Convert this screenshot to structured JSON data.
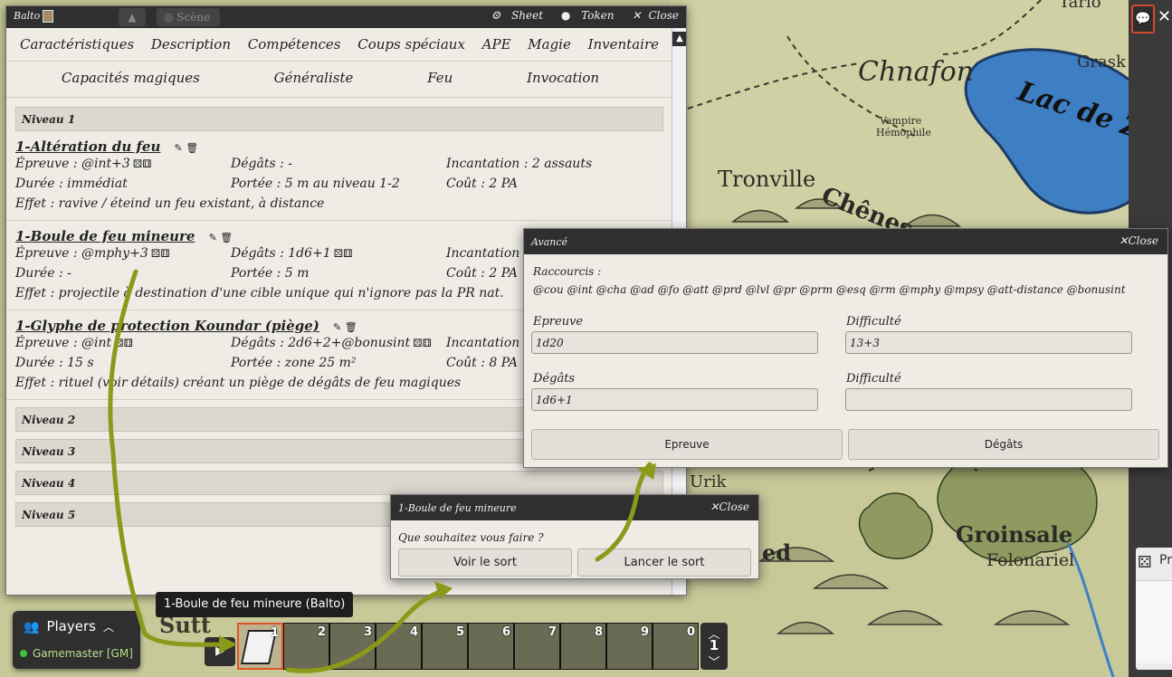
{
  "map": {
    "labels": [
      "Chnafon",
      "Grask",
      "Lac de Zblouf",
      "Vampire",
      "Hémophile",
      "Tronville",
      "Chênes",
      "Urik",
      "Groinsale",
      "Folonariel",
      "ed",
      "Sutt",
      "Tarlo"
    ]
  },
  "sheet": {
    "character_name": "Balto",
    "scene_label": "Scène",
    "actions": {
      "sheet": "Sheet",
      "token": "Token",
      "close": "Close"
    },
    "tabs": [
      "Caractéristiques",
      "Description",
      "Compétences",
      "Coups spéciaux",
      "APE",
      "Magie",
      "Inventaire"
    ],
    "subtabs": [
      "Capacités magiques",
      "Généraliste",
      "Feu",
      "Invocation"
    ],
    "niveau1": "Niveau 1",
    "spells": [
      {
        "name": "1-Altération du feu",
        "epreuve": "Épreuve : @int+3",
        "degats": "Dégâts : -",
        "incantation": "Incantation : 2 assauts",
        "duree": "Durée : immédiat",
        "portee": "Portée : 5 m au niveau 1-2",
        "cout": "Coût : 2 PA",
        "effet": "Effet : ravive / éteind un feu existant, à distance"
      },
      {
        "name": "1-Boule de feu mineure",
        "epreuve": "Épreuve : @mphy+3",
        "degats": "Dégâts : 1d6+1",
        "incantation": "Incantation :",
        "duree": "Durée : -",
        "portee": "Portée : 5 m",
        "cout": "Coût : 2 PA",
        "effet": "Effet : projectile à destination d'une cible unique qui n'ignore pas la PR nat."
      },
      {
        "name": "1-Glyphe de protection Koundar (piège)",
        "epreuve": "Épreuve : @int",
        "degats": "Dégâts : 2d6+2+@bonusint",
        "incantation": "Incantation :",
        "duree": "Durée : 15 s",
        "portee": "Portée : zone 25 m²",
        "cout": "Coût : 8 PA",
        "effet": "Effet : rituel (voir détails) créant un piège de dégâts de feu magiques"
      }
    ],
    "niveaux": [
      "Niveau 2",
      "Niveau 3",
      "Niveau 4",
      "Niveau 5"
    ]
  },
  "avance": {
    "title": "Avancé",
    "close": "Close",
    "raccourcis_label": "Raccourcis :",
    "raccourcis": "@cou @int @cha @ad @fo @att @prd @lvl @pr @prm @esq @rm @mphy @mpsy @att-distance @bonusint",
    "epreuve_label": "Epreuve",
    "epreuve_value": "1d20",
    "difficulte1_label": "Difficulté",
    "difficulte1_value": "13+3",
    "degats_label": "Dégâts",
    "degats_value": "1d6+1",
    "difficulte2_label": "Difficulté",
    "difficulte2_value": "",
    "btn_epreuve": "Epreuve",
    "btn_degats": "Dégâts"
  },
  "boule": {
    "title": "1-Boule de feu mineure",
    "close": "Close",
    "question": "Que souhaitez vous faire ?",
    "btn_voir": "Voir le sort",
    "btn_lancer": "Lancer le sort"
  },
  "tooltip": "1-Boule de feu mineure (Balto)",
  "players": {
    "title": "Players",
    "gm": "Gamemaster [GM]"
  },
  "hotbar": {
    "slots": [
      "1",
      "2",
      "3",
      "4",
      "5",
      "6",
      "7",
      "8",
      "9",
      "0"
    ],
    "page": "1",
    "active_slot": "1"
  },
  "colors": {
    "accent": "#e0542a",
    "arrow": "#8b9a1a",
    "titlebar": "#2f2f2f",
    "parchment": "#efece5"
  },
  "right_panel": {
    "label": "Pr"
  }
}
